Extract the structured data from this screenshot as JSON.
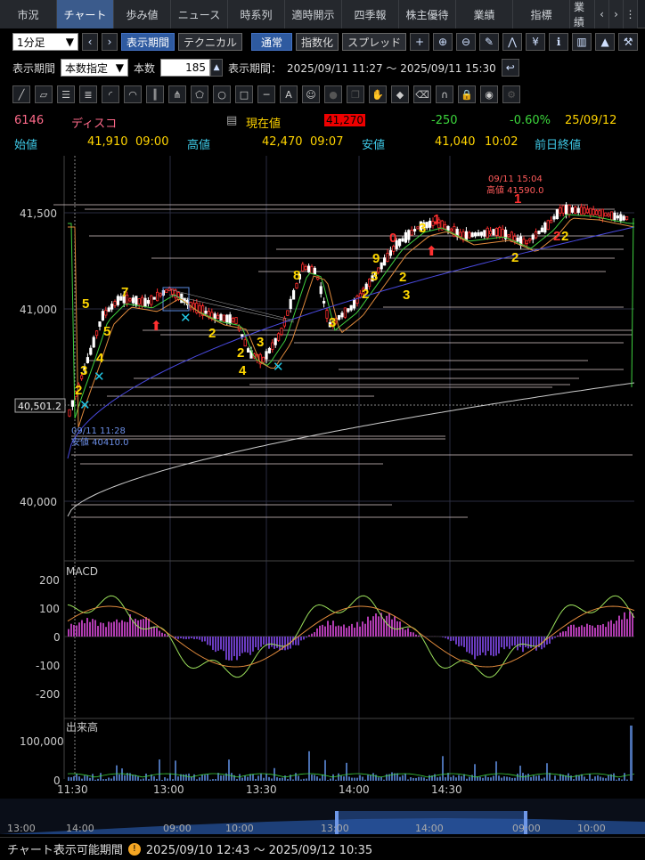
{
  "tabs": [
    "市況",
    "チャート",
    "歩み値",
    "ニュース",
    "時系列",
    "適時開示",
    "四季報",
    "株主優待",
    "業績",
    "指標",
    "業績"
  ],
  "active_tab": 1,
  "toolbar": {
    "interval": "1分足",
    "period_button": "表示期間",
    "technical_button": "テクニカル",
    "mode_normal": "通常",
    "mode_index": "指数化",
    "mode_spread": "スプレッド"
  },
  "range": {
    "label": "表示期間",
    "mode": "本数指定",
    "count_label": "本数",
    "count": "185",
    "period_label": "表示期間：",
    "period_value": "2025/09/11 11:27 ～ 2025/09/11 15:30"
  },
  "stock": {
    "code": "6146",
    "name": "ディスコ",
    "current_label": "現在値",
    "current": "41,270",
    "change": "-250",
    "change_pct": "-0.60%",
    "date": "25/09/12"
  },
  "ohlc": {
    "open_label": "始値",
    "open": "41,910",
    "open_time": "09:00",
    "high_label": "高値",
    "high": "42,470",
    "high_time": "09:07",
    "low_label": "安値",
    "low": "41,040",
    "low_time": "10:02",
    "prev_label": "前日終値"
  },
  "colors": {
    "up": "#ff2d2d",
    "down": "#ffffff",
    "ma1": "#e08a3c",
    "ma2": "#4a4ae0",
    "ma3": "#cccccc",
    "signal_yellow": "#ffd700",
    "signal_red": "#ff3030",
    "cross": "#22c8e6",
    "macd_pos": "#b03cb0",
    "macd_neg": "#6a3cc0"
  },
  "chart_data": {
    "type": "candlestick",
    "y_ticks": [
      "41,500",
      "41,000",
      "40,000"
    ],
    "y_marker": "40,501.2",
    "x_ticks": [
      "11:30",
      "13:00",
      "13:30",
      "14:00",
      "14:30"
    ],
    "high_annotation": {
      "time": "09/11 15:04",
      "text": "高値 41590.0"
    },
    "low_annotation": {
      "time": "09/11 11:28",
      "text": "安値 40410.0"
    },
    "macd": {
      "label": "MACD",
      "ticks": [
        "200",
        "100",
        "0",
        "-100",
        "-200"
      ]
    },
    "volume": {
      "label": "出来高",
      "ticks": [
        "100,000",
        "0"
      ]
    },
    "navigator_ticks": [
      "13:00",
      "14:00",
      "09:00",
      "10:00",
      "13:00",
      "14:00",
      "09:00",
      "10:00"
    ],
    "signals": [
      {
        "t": "5"
      },
      {
        "t": "7"
      },
      {
        "t": "5"
      },
      {
        "t": "4"
      },
      {
        "t": "3"
      },
      {
        "t": "2"
      },
      {
        "t": "2"
      },
      {
        "t": "3"
      },
      {
        "t": "4"
      },
      {
        "t": "2"
      },
      {
        "t": "8"
      },
      {
        "t": "3"
      },
      {
        "t": "2"
      },
      {
        "t": "3"
      },
      {
        "t": "9"
      },
      {
        "t": "0"
      },
      {
        "t": "2"
      },
      {
        "t": "3"
      },
      {
        "t": "1"
      },
      {
        "t": "3"
      },
      {
        "t": "2"
      },
      {
        "t": "1"
      },
      {
        "t": "2"
      },
      {
        "t": "2"
      }
    ]
  },
  "footer": {
    "label": "チャート表示可能期間",
    "period": "2025/09/10 12:43 ～ 2025/09/12 10:35"
  }
}
